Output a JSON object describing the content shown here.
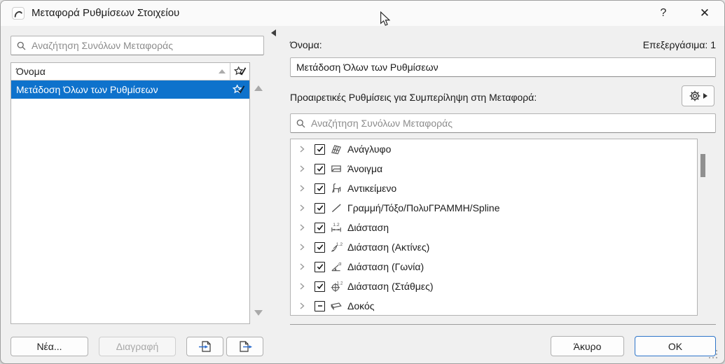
{
  "window": {
    "title": "Μεταφορά Ρυθμίσεων Στοιχείου",
    "help_label": "?",
    "close_label": "✕"
  },
  "left_panel": {
    "search_placeholder": "Αναζήτηση Συνόλων Μεταφοράς",
    "list_header": "Όνομα",
    "rows": [
      {
        "name": "Μετάδοση Όλων των Ρυθμίσεων",
        "selected": true,
        "favorite": true
      }
    ],
    "buttons": {
      "new_label": "Νέα...",
      "delete_label": "Διαγραφή"
    }
  },
  "right_panel": {
    "name_label": "Όνομα:",
    "editable_count_label": "Επεξεργάσιμα: 1",
    "name_value": "Μετάδοση Όλων των Ρυθμίσεων",
    "optional_settings_label": "Προαιρετικές Ρυθμίσεις για Συμπερίληψη στη Μεταφορά:",
    "search_placeholder": "Αναζήτηση Συνόλων Μεταφοράς",
    "tree_items": [
      {
        "label": "Ανάγλυφο",
        "state": "checked",
        "icon": "mesh-icon"
      },
      {
        "label": "Άνοιγμα",
        "state": "checked",
        "icon": "opening-icon"
      },
      {
        "label": "Αντικείμενο",
        "state": "checked",
        "icon": "object-icon"
      },
      {
        "label": "Γραμμή/Τόξο/ΠολυΓΡΑΜΜΗ/Spline",
        "state": "checked",
        "icon": "line-icon"
      },
      {
        "label": "Διάσταση",
        "state": "checked",
        "icon": "dimension-icon"
      },
      {
        "label": "Διάσταση (Ακτίνες)",
        "state": "checked",
        "icon": "radial-dimension-icon"
      },
      {
        "label": "Διάσταση (Γωνία)",
        "state": "checked",
        "icon": "angle-dimension-icon"
      },
      {
        "label": "Διάσταση (Στάθμες)",
        "state": "checked",
        "icon": "level-dimension-icon"
      },
      {
        "label": "Δοκός",
        "state": "mixed",
        "icon": "beam-icon"
      }
    ]
  },
  "footer": {
    "cancel_label": "Άκυρο",
    "ok_label": "OK"
  },
  "colors": {
    "selection_blue": "#0e72cc",
    "ok_border_blue": "#2e75c9",
    "arrow_blue": "#2e6fd0"
  }
}
